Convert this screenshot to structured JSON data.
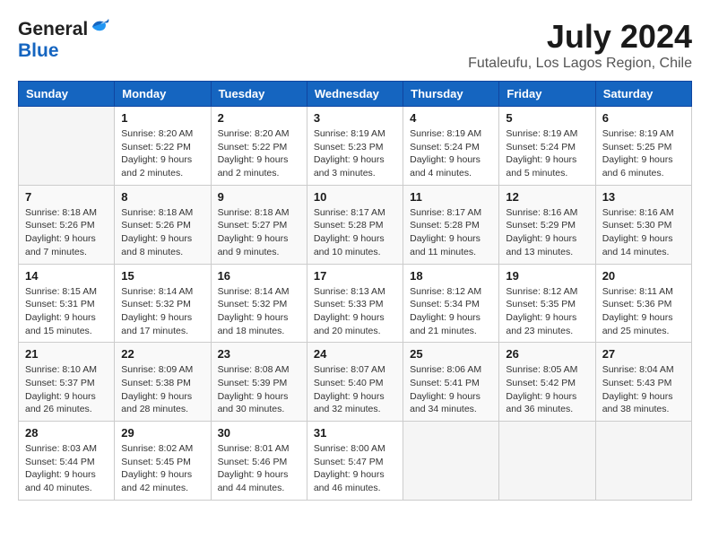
{
  "header": {
    "logo_general": "General",
    "logo_blue": "Blue",
    "month_year": "July 2024",
    "location": "Futaleufu, Los Lagos Region, Chile"
  },
  "days_header": [
    "Sunday",
    "Monday",
    "Tuesday",
    "Wednesday",
    "Thursday",
    "Friday",
    "Saturday"
  ],
  "weeks": [
    [
      {
        "day": "",
        "sunrise": "",
        "sunset": "",
        "daylight": ""
      },
      {
        "day": "1",
        "sunrise": "Sunrise: 8:20 AM",
        "sunset": "Sunset: 5:22 PM",
        "daylight": "Daylight: 9 hours and 2 minutes."
      },
      {
        "day": "2",
        "sunrise": "Sunrise: 8:20 AM",
        "sunset": "Sunset: 5:22 PM",
        "daylight": "Daylight: 9 hours and 2 minutes."
      },
      {
        "day": "3",
        "sunrise": "Sunrise: 8:19 AM",
        "sunset": "Sunset: 5:23 PM",
        "daylight": "Daylight: 9 hours and 3 minutes."
      },
      {
        "day": "4",
        "sunrise": "Sunrise: 8:19 AM",
        "sunset": "Sunset: 5:24 PM",
        "daylight": "Daylight: 9 hours and 4 minutes."
      },
      {
        "day": "5",
        "sunrise": "Sunrise: 8:19 AM",
        "sunset": "Sunset: 5:24 PM",
        "daylight": "Daylight: 9 hours and 5 minutes."
      },
      {
        "day": "6",
        "sunrise": "Sunrise: 8:19 AM",
        "sunset": "Sunset: 5:25 PM",
        "daylight": "Daylight: 9 hours and 6 minutes."
      }
    ],
    [
      {
        "day": "7",
        "sunrise": "Sunrise: 8:18 AM",
        "sunset": "Sunset: 5:26 PM",
        "daylight": "Daylight: 9 hours and 7 minutes."
      },
      {
        "day": "8",
        "sunrise": "Sunrise: 8:18 AM",
        "sunset": "Sunset: 5:26 PM",
        "daylight": "Daylight: 9 hours and 8 minutes."
      },
      {
        "day": "9",
        "sunrise": "Sunrise: 8:18 AM",
        "sunset": "Sunset: 5:27 PM",
        "daylight": "Daylight: 9 hours and 9 minutes."
      },
      {
        "day": "10",
        "sunrise": "Sunrise: 8:17 AM",
        "sunset": "Sunset: 5:28 PM",
        "daylight": "Daylight: 9 hours and 10 minutes."
      },
      {
        "day": "11",
        "sunrise": "Sunrise: 8:17 AM",
        "sunset": "Sunset: 5:28 PM",
        "daylight": "Daylight: 9 hours and 11 minutes."
      },
      {
        "day": "12",
        "sunrise": "Sunrise: 8:16 AM",
        "sunset": "Sunset: 5:29 PM",
        "daylight": "Daylight: 9 hours and 13 minutes."
      },
      {
        "day": "13",
        "sunrise": "Sunrise: 8:16 AM",
        "sunset": "Sunset: 5:30 PM",
        "daylight": "Daylight: 9 hours and 14 minutes."
      }
    ],
    [
      {
        "day": "14",
        "sunrise": "Sunrise: 8:15 AM",
        "sunset": "Sunset: 5:31 PM",
        "daylight": "Daylight: 9 hours and 15 minutes."
      },
      {
        "day": "15",
        "sunrise": "Sunrise: 8:14 AM",
        "sunset": "Sunset: 5:32 PM",
        "daylight": "Daylight: 9 hours and 17 minutes."
      },
      {
        "day": "16",
        "sunrise": "Sunrise: 8:14 AM",
        "sunset": "Sunset: 5:32 PM",
        "daylight": "Daylight: 9 hours and 18 minutes."
      },
      {
        "day": "17",
        "sunrise": "Sunrise: 8:13 AM",
        "sunset": "Sunset: 5:33 PM",
        "daylight": "Daylight: 9 hours and 20 minutes."
      },
      {
        "day": "18",
        "sunrise": "Sunrise: 8:12 AM",
        "sunset": "Sunset: 5:34 PM",
        "daylight": "Daylight: 9 hours and 21 minutes."
      },
      {
        "day": "19",
        "sunrise": "Sunrise: 8:12 AM",
        "sunset": "Sunset: 5:35 PM",
        "daylight": "Daylight: 9 hours and 23 minutes."
      },
      {
        "day": "20",
        "sunrise": "Sunrise: 8:11 AM",
        "sunset": "Sunset: 5:36 PM",
        "daylight": "Daylight: 9 hours and 25 minutes."
      }
    ],
    [
      {
        "day": "21",
        "sunrise": "Sunrise: 8:10 AM",
        "sunset": "Sunset: 5:37 PM",
        "daylight": "Daylight: 9 hours and 26 minutes."
      },
      {
        "day": "22",
        "sunrise": "Sunrise: 8:09 AM",
        "sunset": "Sunset: 5:38 PM",
        "daylight": "Daylight: 9 hours and 28 minutes."
      },
      {
        "day": "23",
        "sunrise": "Sunrise: 8:08 AM",
        "sunset": "Sunset: 5:39 PM",
        "daylight": "Daylight: 9 hours and 30 minutes."
      },
      {
        "day": "24",
        "sunrise": "Sunrise: 8:07 AM",
        "sunset": "Sunset: 5:40 PM",
        "daylight": "Daylight: 9 hours and 32 minutes."
      },
      {
        "day": "25",
        "sunrise": "Sunrise: 8:06 AM",
        "sunset": "Sunset: 5:41 PM",
        "daylight": "Daylight: 9 hours and 34 minutes."
      },
      {
        "day": "26",
        "sunrise": "Sunrise: 8:05 AM",
        "sunset": "Sunset: 5:42 PM",
        "daylight": "Daylight: 9 hours and 36 minutes."
      },
      {
        "day": "27",
        "sunrise": "Sunrise: 8:04 AM",
        "sunset": "Sunset: 5:43 PM",
        "daylight": "Daylight: 9 hours and 38 minutes."
      }
    ],
    [
      {
        "day": "28",
        "sunrise": "Sunrise: 8:03 AM",
        "sunset": "Sunset: 5:44 PM",
        "daylight": "Daylight: 9 hours and 40 minutes."
      },
      {
        "day": "29",
        "sunrise": "Sunrise: 8:02 AM",
        "sunset": "Sunset: 5:45 PM",
        "daylight": "Daylight: 9 hours and 42 minutes."
      },
      {
        "day": "30",
        "sunrise": "Sunrise: 8:01 AM",
        "sunset": "Sunset: 5:46 PM",
        "daylight": "Daylight: 9 hours and 44 minutes."
      },
      {
        "day": "31",
        "sunrise": "Sunrise: 8:00 AM",
        "sunset": "Sunset: 5:47 PM",
        "daylight": "Daylight: 9 hours and 46 minutes."
      },
      {
        "day": "",
        "sunrise": "",
        "sunset": "",
        "daylight": ""
      },
      {
        "day": "",
        "sunrise": "",
        "sunset": "",
        "daylight": ""
      },
      {
        "day": "",
        "sunrise": "",
        "sunset": "",
        "daylight": ""
      }
    ]
  ]
}
